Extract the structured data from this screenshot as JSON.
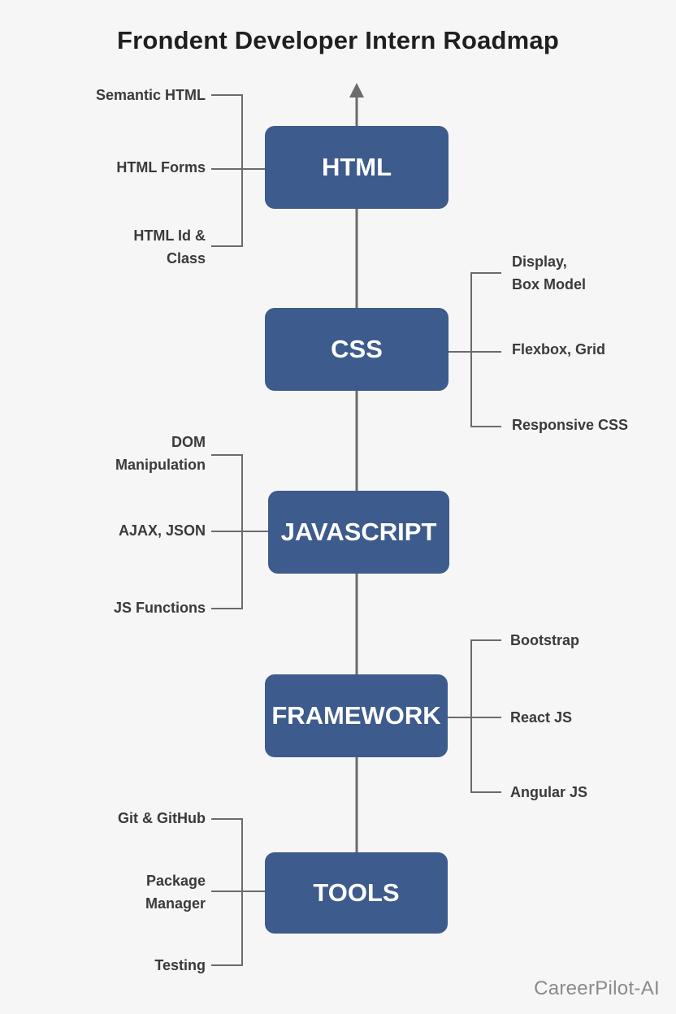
{
  "title": "Frondent Developer Intern Roadmap",
  "watermark": "CareerPilot-AI",
  "colors": {
    "node_fill": "#3d5b8c",
    "node_text": "#ffffff",
    "line": "#6b6b6b",
    "topic_text": "#3a3a3a",
    "background": "#f6f6f6"
  },
  "stages": [
    {
      "label": "HTML",
      "side": "left",
      "topics": [
        "Semantic HTML",
        "HTML Forms",
        "HTML Id &\nClass"
      ]
    },
    {
      "label": "CSS",
      "side": "right",
      "topics": [
        "Display,\nBox Model",
        "Flexbox, Grid",
        "Responsive CSS"
      ]
    },
    {
      "label": "JAVASCRIPT",
      "side": "left",
      "topics": [
        "DOM\nManipulation",
        "AJAX, JSON",
        "JS Functions"
      ]
    },
    {
      "label": "FRAMEWORK",
      "side": "right",
      "topics": [
        "Bootstrap",
        "React JS",
        "Angular JS"
      ]
    },
    {
      "label": "TOOLS",
      "side": "left",
      "topics": [
        "Git & GitHub",
        "Package\nManager",
        "Testing"
      ]
    }
  ]
}
